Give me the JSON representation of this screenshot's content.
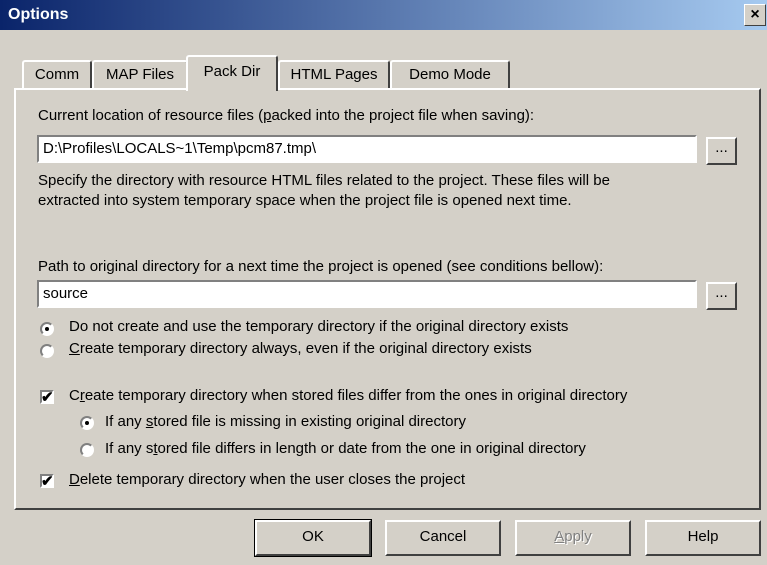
{
  "window": {
    "title": "Options",
    "close_glyph": "×"
  },
  "tabs": [
    {
      "label": "Comm",
      "active": false
    },
    {
      "label": "MAP Files",
      "active": false
    },
    {
      "label": "Pack Dir",
      "active": true
    },
    {
      "label": "HTML Pages",
      "active": false
    },
    {
      "label": "Demo Mode",
      "active": false
    }
  ],
  "resource": {
    "label_pre": "Current location of resource files (",
    "label_mn": "p",
    "label_post": "acked into the project file when saving):",
    "value": "D:\\Profiles\\LOCALS~1\\Temp\\pcm87.tmp\\",
    "browse_label": "...",
    "desc_line1": "Specify the directory with resource HTML files related to the project. These files will be",
    "desc_line2": "extracted into system temporary space when the project file is opened next time."
  },
  "original": {
    "label": "Path to original directory for a next time the project is opened (see conditions bellow):",
    "value": "source",
    "browse_label": "..."
  },
  "options": {
    "radio_no_create": {
      "label": "Do not create and use the temporary directory if the original directory exists",
      "checked": true
    },
    "radio_always": {
      "mn": "C",
      "label_rest": "reate temporary directory always, even if the original directory exists",
      "checked": false
    },
    "check_differ": {
      "pre": "C",
      "mn": "r",
      "post": "eate temporary directory when stored files differ from the ones in original directory",
      "checked": true
    },
    "radio_missing": {
      "pre": "If any ",
      "mn": "s",
      "post": "tored file is missing in existing original directory",
      "checked": true
    },
    "radio_differs": {
      "pre": "If any s",
      "mn": "t",
      "post": "ored file differs in length or date from the one in original directory",
      "checked": false
    },
    "check_delete": {
      "mn": "D",
      "post": "elete temporary directory when the user closes the project",
      "checked": true
    }
  },
  "footer": {
    "ok": "OK",
    "cancel": "Cancel",
    "apply_mn": "A",
    "apply_rest": "pply",
    "help": "Help"
  },
  "check_glyph": "✔"
}
